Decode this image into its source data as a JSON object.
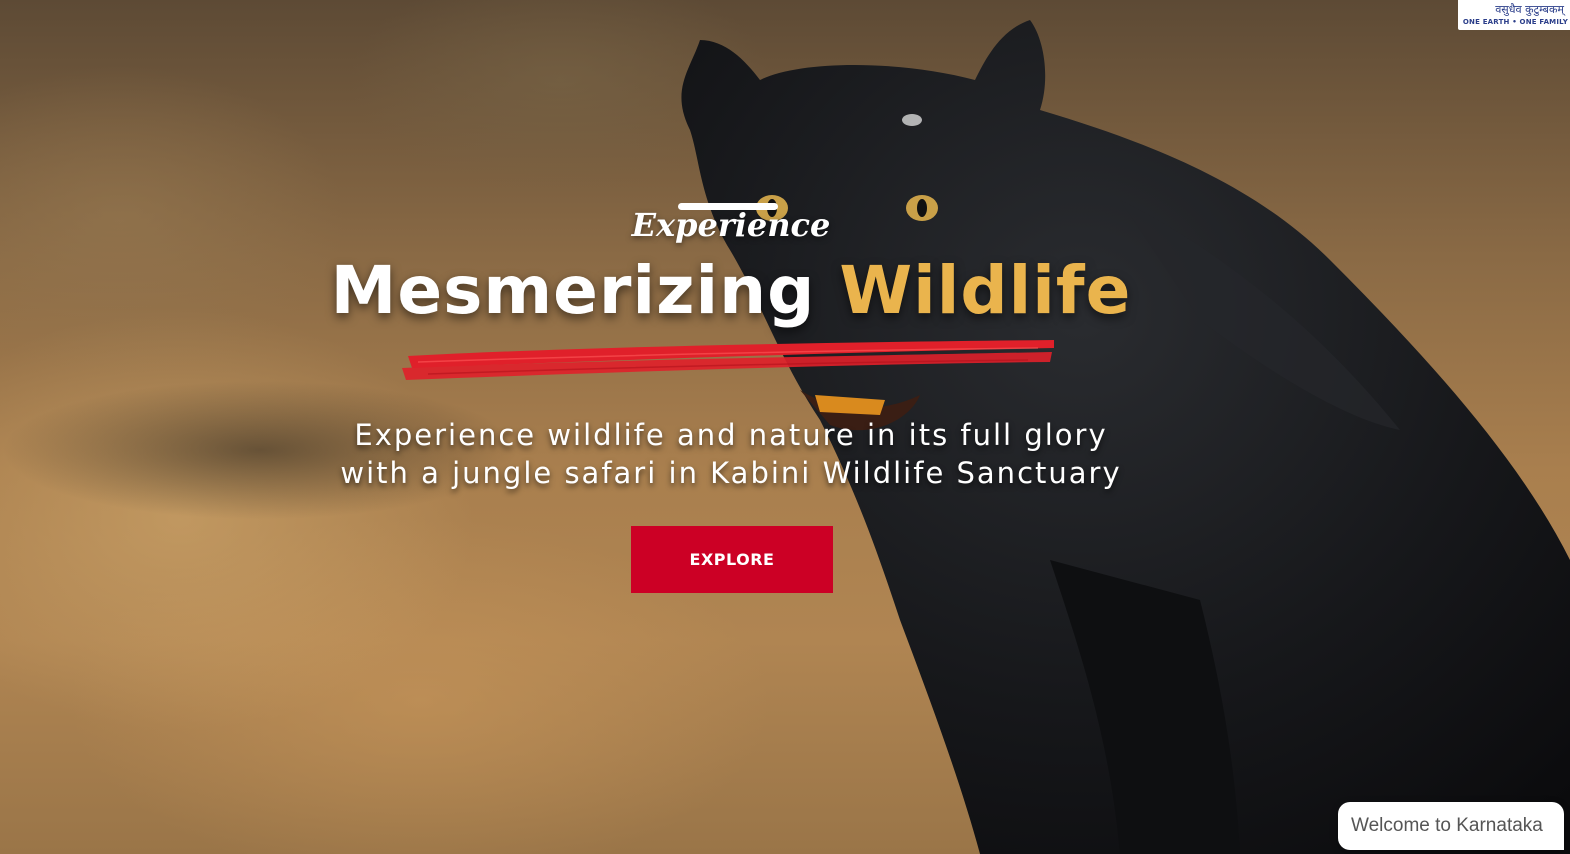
{
  "hero": {
    "kicker": "Experience",
    "headline_main": "Mesmerizing ",
    "headline_accent": "Wildlife",
    "subtitle_line1": "Experience wildlife and nature in its full glory",
    "subtitle_line2": "with a jungle safari in Kabini Wildlife Sanctuary",
    "cta_label": "EXPLORE",
    "background_subject": "black-panther-photo"
  },
  "logo": {
    "top_text": "वसुधैव कुटुम्बकम्",
    "bottom_text": "ONE EARTH • ONE FAMILY"
  },
  "chat": {
    "greeting": "Welcome to Karnataka"
  },
  "colors": {
    "accent_yellow": "#eab44d",
    "cta_red": "#cc0025",
    "brush_red": "#e0202a",
    "text_white": "#ffffff"
  }
}
